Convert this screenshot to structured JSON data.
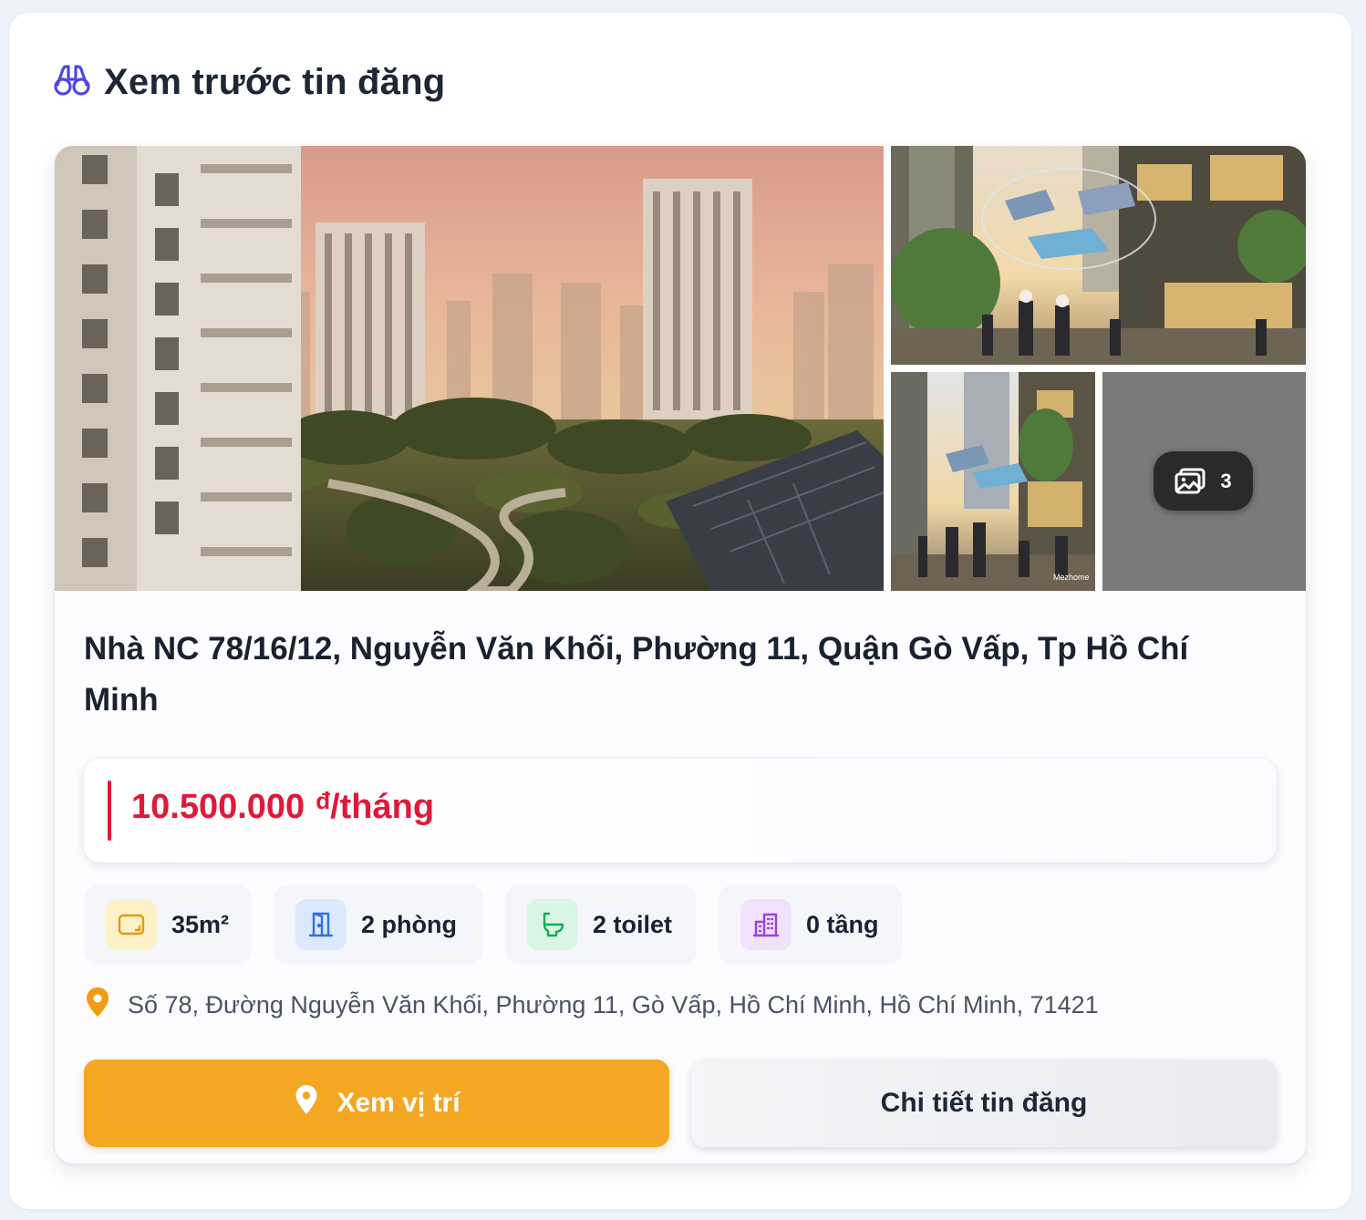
{
  "header": {
    "title": "Xem trước tin đăng",
    "icon": "binoculars-icon",
    "accent": "#4f46e5"
  },
  "gallery": {
    "images": [
      {
        "name": "main-photo",
        "alt": ""
      },
      {
        "name": "photo-2",
        "alt": ""
      },
      {
        "name": "photo-3",
        "alt": ""
      }
    ],
    "more_count": "3",
    "watermark": "Mezhome"
  },
  "listing": {
    "title": "Nhà NC 78/16/12, Nguyễn Văn Khối, Phường 11, Quận Gò Vấp, Tp Hồ Chí Minh",
    "price_amount": "10.500.000",
    "price_currency": "đ",
    "price_unit": "/tháng",
    "price_color": "#e0193a",
    "specs": [
      {
        "label": "35m²",
        "icon": "area-icon",
        "color": "#f59e0b"
      },
      {
        "label": "2 phòng",
        "icon": "door-icon",
        "color": "#3b82f6"
      },
      {
        "label": "2 toilet",
        "icon": "toilet-icon",
        "color": "#22c55e"
      },
      {
        "label": "0 tầng",
        "icon": "building-icon",
        "color": "#a855f7"
      }
    ],
    "address": "Số 78, Đường Nguyễn Văn Khối, Phường 11, Gò Vấp, Hồ Chí Minh, Hồ Chí Minh, 71421"
  },
  "actions": {
    "location_label": "Xem vị trí",
    "detail_label": "Chi tiết tin đăng",
    "location_color": "#f3a722"
  }
}
